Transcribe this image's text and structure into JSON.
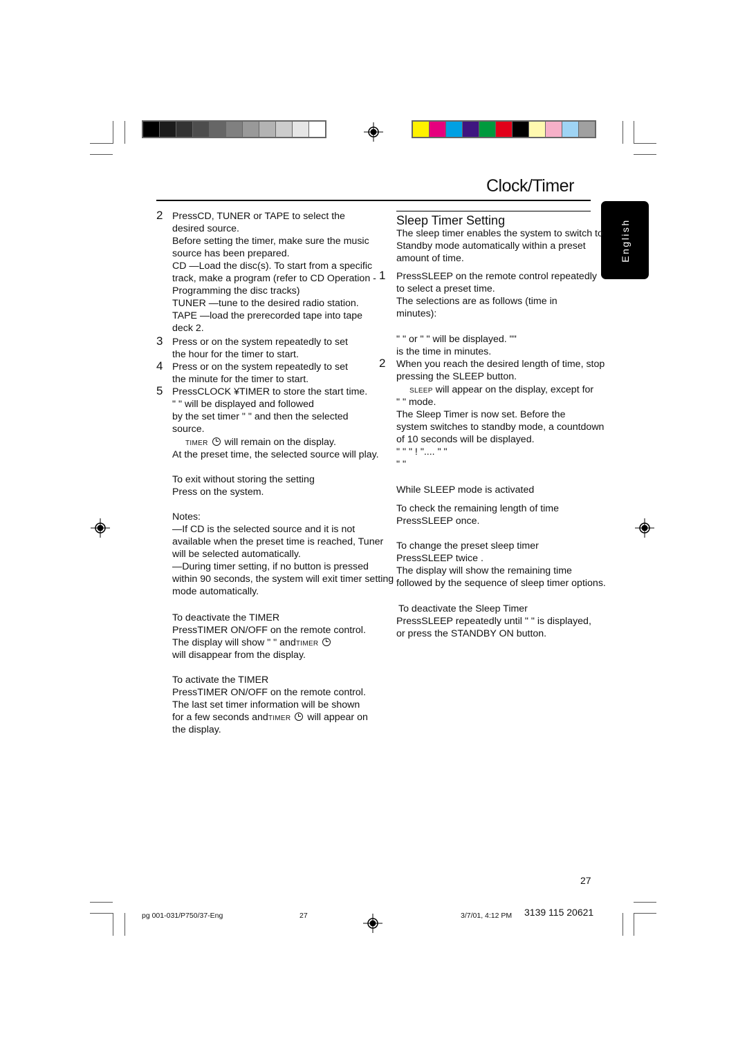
{
  "color_bars": {
    "grayscale": [
      "#000000",
      "#1c1c1c",
      "#333333",
      "#4d4d4d",
      "#666666",
      "#808080",
      "#999999",
      "#b3b3b3",
      "#cccccc",
      "#e6e6e6",
      "#ffffff"
    ],
    "colors": [
      "#fff200",
      "#e6007e",
      "#00a0e3",
      "#3f1580",
      "#009a3e",
      "#e2001a",
      "#000000",
      "#fff9b0",
      "#f6b0c8",
      "#9fd4f4",
      "#a0a0a0"
    ]
  },
  "header": {
    "title": "Clock/Timer"
  },
  "language_tab": {
    "label": "English"
  },
  "left_column": {
    "steps": [
      {
        "number": "2",
        "lines": [
          "PressCD, TUNER  or TAPE  to select the",
          "desired source.",
          "Before setting the timer, make sure the music",
          "source has been prepared.",
          "CD —Load the disc(s). To start from a specific",
          "track, make a program (refer to CD Operation -",
          "Programming the disc tracks)",
          "TUNER  —tune to the desired radio station.",
          "TAPE  —load the prerecorded tape into tape",
          "deck 2."
        ]
      },
      {
        "number": "3",
        "lines": [
          "Press     or        on the system repeatedly to set",
          "the hour for the timer to start."
        ]
      },
      {
        "number": "4",
        "lines": [
          "Press     or       on the system repeatedly to set",
          "the minute for the timer to start."
        ]
      },
      {
        "number": "5",
        "lines": [
          "PressCLOCK ¥TIMER  to store the start time.",
          "  \"                 \" will be displayed and followed",
          "by the set timer \"        \" and then the selected",
          "source."
        ]
      }
    ],
    "timer_remain": {
      "indicator": "TIMER",
      "text": " will remain on the display."
    },
    "preset_play": "At the preset time, the selected source will play.",
    "exit_heading": "To exit without storing the setting",
    "exit_text": "Press    on the system.",
    "notes_heading": "Notes:",
    "notes_lines": [
      "—If CD is the selected source and it is not",
      "available when the preset time is reached, Tuner",
      "will be selected automatically.",
      "—During timer setting, if no button is pressed",
      "within 90 seconds, the system will exit timer setting",
      "mode automatically."
    ],
    "deactivate_heading": "To deactivate the TIMER",
    "deactivate_lines": [
      "PressTIMER ON/OFF   on the remote control.",
      "   The display will show \"         \" and",
      "will disappear from the display."
    ],
    "activate_heading": "To activate the TIMER",
    "activate_lines": [
      "PressTIMER ON/OFF   on the remote control.",
      "   The last set timer information will be shown",
      "for a few seconds and",
      " will appear on",
      "the display."
    ],
    "indicator_timer": "TIMER"
  },
  "right_column": {
    "heading": "Sleep Timer Setting",
    "intro_lines": [
      "The sleep timer enables the system to switch to",
      "Standby mode automatically within a preset",
      "amount of time."
    ],
    "step1_number": "1",
    "step1_lines": [
      "PressSLEEP on the remote control repeatedly",
      "to select a preset time.",
      "   The selections are as follows (time in",
      "minutes):"
    ],
    "display_lines": [
      "   \"                    \" or \"       \" will be displayed. \"\"",
      "is the time in minutes."
    ],
    "step2_number": "2",
    "step2_lines": [
      "When you reach the desired length of time, stop",
      "pressing the SLEEP button."
    ],
    "sleep_indicator": "SLEEP",
    "sleep_appear": " will appear on the display, except for",
    "mode_line": "\"      \" mode.",
    "set_lines": [
      "   The Sleep Timer is now set. Before the",
      "system switches to standby mode, a countdown",
      "of 10 seconds will be displayed."
    ],
    "countdown_lines": [
      "   \"                   \"   \"       !        \"....   \"                   \"",
      "      \"           \""
    ],
    "while_heading": "While SLEEP mode is activated",
    "check_heading": "To check the remaining length of time",
    "check_text": "PressSLEEP once.",
    "change_heading": "To change the preset sleep timer",
    "change_lines": [
      "PressSLEEP twice .",
      "   The display will show the remaining time",
      "followed by the sequence of sleep timer options."
    ],
    "deact_heading": "To deactivate the Sleep Timer",
    "deact_lines": [
      "PressSLEEP repeatedly until \"    \" is displayed,",
      "or press the STANDBY ON    button."
    ]
  },
  "page_number": "27",
  "footer": {
    "file": "pg 001-031/P750/37-Eng",
    "page": "27",
    "date": "3/7/01, 4:12 PM",
    "code": "3139 115 20621"
  }
}
